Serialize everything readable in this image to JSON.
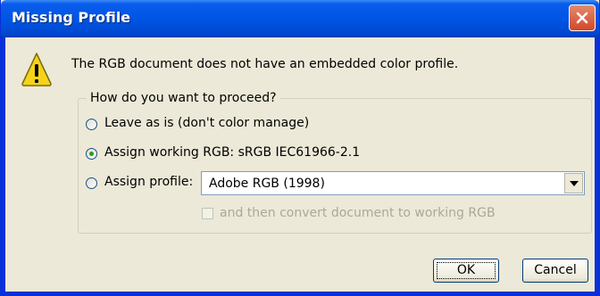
{
  "window": {
    "title": "Missing Profile"
  },
  "message": "The RGB document does not have an embedded color profile.",
  "group": {
    "legend": "How do you want to proceed?",
    "options": [
      {
        "label": "Leave as is (don't color manage)",
        "selected": false
      },
      {
        "label": "Assign working RGB:  sRGB IEC61966-2.1",
        "selected": true
      },
      {
        "label": "Assign profile:",
        "selected": false
      }
    ],
    "profile_select": {
      "value": "Adobe RGB (1998)"
    },
    "convert_checkbox": {
      "label": "and then convert document to working RGB",
      "checked": false,
      "enabled": false
    }
  },
  "buttons": {
    "ok": "OK",
    "cancel": "Cancel"
  },
  "colors": {
    "titlebar": "#0055e5",
    "face": "#ece9d8",
    "radio_dot": "#21a121",
    "warning": "#f5d31b"
  },
  "icons": [
    "close-icon",
    "warning-icon",
    "dropdown-arrow-icon"
  ]
}
